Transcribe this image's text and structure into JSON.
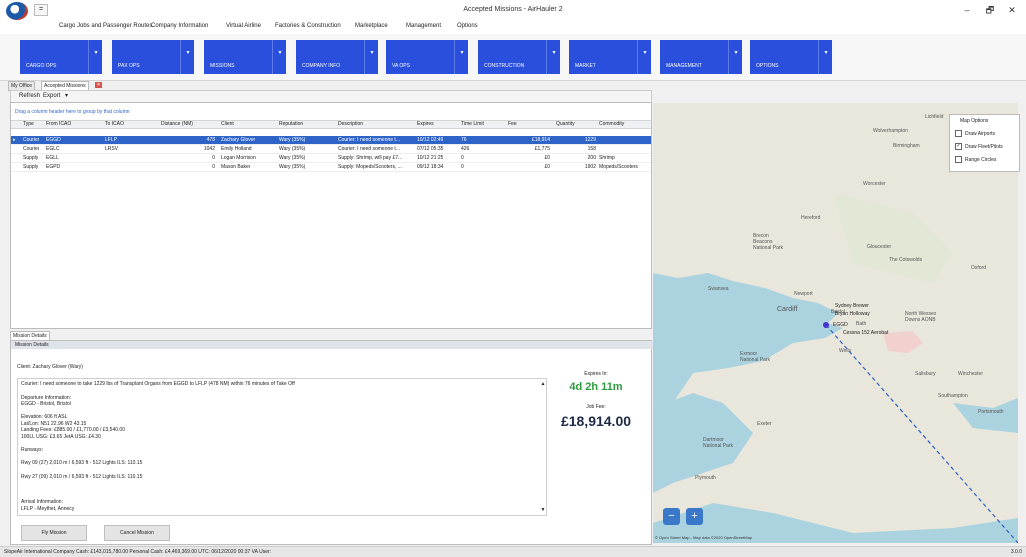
{
  "window": {
    "title": "Accepted Missions - AirHauler 2",
    "minimize": "–",
    "maximize": "🗗",
    "close": "✕"
  },
  "qat": "=",
  "menu": [
    "Cargo Jobs and Passenger Routes",
    "Company Information",
    "Virtual Airline",
    "Factories & Construction",
    "Marketplace",
    "Management",
    "Options"
  ],
  "ribbon": [
    "CARGO OPS",
    "PAX OPS",
    "MISSIONS",
    "COMPANY INFO",
    "VA OPS",
    "CONSTRUCTION",
    "MARKET",
    "MANAGEMENT",
    "OPTIONS"
  ],
  "doc_tabs": [
    "My Office",
    "Accepted Missions"
  ],
  "tab_close": "✕",
  "toolbar": {
    "refresh": "Refresh",
    "export": "Export"
  },
  "grid": {
    "group_hint": "Drag a column header here to group by that column",
    "columns": [
      "Type",
      "From ICAO",
      "To ICAO",
      "Distance (NM)",
      "Client",
      "Reputation",
      "Description",
      "Expires",
      "Time Limit",
      "Fee",
      "Quantity",
      "Commodity"
    ],
    "rows": [
      {
        "type": "Courier",
        "from": "EGGD",
        "to": "LFLP",
        "distance": "478",
        "client": "Zachary Glover",
        "reputation": "Wary (35%)",
        "description": "Courier: I need someone t...",
        "expires": "10/12 02:49",
        "time_limit": "76",
        "fee": "£18,914",
        "quantity": "1229",
        "commodity": ""
      },
      {
        "type": "Courier",
        "from": "EGLC",
        "to": "LRSV",
        "distance": "1042",
        "client": "Emily Holland",
        "reputation": "Wary (35%)",
        "description": "Courier: I need someone t...",
        "expires": "07/12 05:35",
        "time_limit": "426",
        "fee": "£1,775",
        "quantity": "158",
        "commodity": ""
      },
      {
        "type": "Supply",
        "from": "EGLL",
        "to": "",
        "distance": "0",
        "client": "Logan Morrison",
        "reputation": "Wary (35%)",
        "description": "Supply: Shrimp, will pay £7...",
        "expires": "10/12 21:25",
        "time_limit": "0",
        "fee": "£0",
        "quantity": "200",
        "commodity": "Shrimp"
      },
      {
        "type": "Supply",
        "from": "EGPD",
        "to": "",
        "distance": "0",
        "client": "Mason Baker",
        "reputation": "Wary (35%)",
        "description": "Supply: Mopeds/Scooters, ...",
        "expires": "09/12 18:34",
        "time_limit": "0",
        "fee": "£0",
        "quantity": "1902",
        "commodity": "Mopeds/Scooters"
      }
    ]
  },
  "details": {
    "tab": "Mission Details",
    "header": "Mission Details",
    "client": "Client:    Zachary Glover  (Wary)",
    "lines": [
      "Courier: I need someone to take 1229 lbs of Transplant Organs from EGGD to LFLP (478 NM) within 76 minutes of Take Off",
      "",
      "Departure Information:",
      "EGGD - Bristol, Bristol",
      "",
      "Elevation: 606 ft ASL",
      "Lat/Lon: N51 22.96   W2 43.15",
      "Landing Fees: £885.00 / £1,770.00 / £3,540.00",
      "100LL USG: £3.65  JetA USG: £4.30",
      "",
      "Runways:",
      "",
      "Rwy 09 (27)          2,010 m / 6,593 ft -          512       Lights     ILS: 110.15",
      "",
      "Rwy 27 (09)          2,010 m / 6,593 ft -          512       Lights     ILS: 110.15",
      "",
      "",
      "",
      "Arrival Information:",
      "LFLP - Meythet, Annecy"
    ],
    "expires_label": "Expires In:",
    "expires_value": "4d 2h 11m",
    "fee_label": "Job Fee:",
    "fee_value": "£18,914.00",
    "fly_button": "Fly Mission",
    "cancel_button": "Cancel Mission"
  },
  "map": {
    "options_title": "Map Options",
    "options": [
      {
        "label": "Draw Airports",
        "checked": false
      },
      {
        "label": "Draw Fleet/Pilots",
        "checked": true
      },
      {
        "label": "Range Circles",
        "checked": false
      }
    ],
    "check_mark": "✓",
    "labels": [
      "Birmingham",
      "Wolverhampton",
      "Lichfield",
      "Worcester",
      "Hereford",
      "Brecon Beacons National Park",
      "Gloucester",
      "The Cotswolds",
      "Oxford",
      "Swansea",
      "Newport",
      "Cardiff",
      "Bristol",
      "Bath",
      "Wells",
      "North Wessex Downs AONB",
      "Salisbury",
      "Winchester",
      "Southampton",
      "Portsmouth",
      "Exmoor National Park",
      "Exeter",
      "Dartmoor National Park",
      "Plymouth",
      "Sydney Brewer",
      "Bryan Holloway",
      "EGGD",
      "Cessna 152 Aerobat"
    ],
    "zoom_out": "−",
    "zoom_in": "+",
    "attribution": "© Open Street Map - Map data ©2020 OpenStreetMap"
  },
  "status": "SlopeAir International   Company Cash: £143,015,780.00    Personal Cash: £4,469,369.00   UTC: 06/12/2020  00:37   VA User:",
  "version": "3.0.0",
  "colors": {
    "ribbon_blue": "#2a4fdc",
    "selected_row": "#2e64c8",
    "expires_green": "#2e9a3d"
  }
}
